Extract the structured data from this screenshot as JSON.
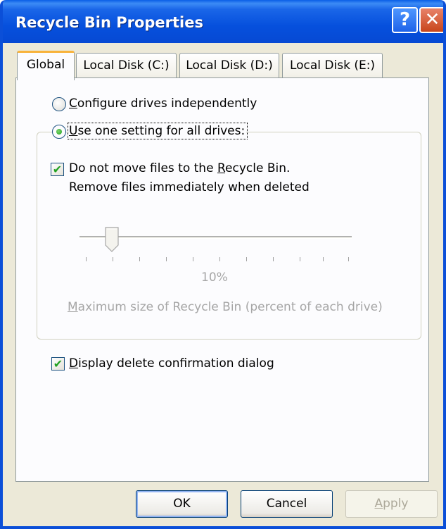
{
  "window": {
    "title": "Recycle Bin Properties",
    "help_label": "?",
    "close_label": "✕"
  },
  "tabs": [
    {
      "label": "Global",
      "active": true
    },
    {
      "label": "Local Disk (C:)",
      "active": false
    },
    {
      "label": "Local Disk (D:)",
      "active": false
    },
    {
      "label": "Local Disk (E:)",
      "active": false
    }
  ],
  "options": {
    "configure_independently": {
      "label_accel": "C",
      "label_rest": "onfigure drives independently",
      "selected": false
    },
    "use_one_setting": {
      "label_accel": "U",
      "label_rest": "se one setting for all drives:",
      "selected": true
    }
  },
  "global_group": {
    "do_not_move": {
      "line1_prefix": "Do not move files to the ",
      "line1_accel": "R",
      "line1_suffix": "ecycle Bin.",
      "line2": "Remove files immediately when deleted",
      "checked": true
    },
    "slider": {
      "value_label": "10%",
      "value_percent": 10,
      "enabled": false
    },
    "max_size_accel": "M",
    "max_size_rest": "aximum size of Recycle Bin (percent of each drive)"
  },
  "display_confirmation": {
    "label_accel": "D",
    "label_rest": "isplay delete confirmation dialog",
    "checked": true
  },
  "buttons": {
    "ok": "OK",
    "cancel": "Cancel",
    "apply_accel": "A",
    "apply_rest": "pply"
  },
  "colors": {
    "title_bar": "#0650dd",
    "check_mark": "#21a121",
    "active_tab_accent": "#f8b33b"
  }
}
